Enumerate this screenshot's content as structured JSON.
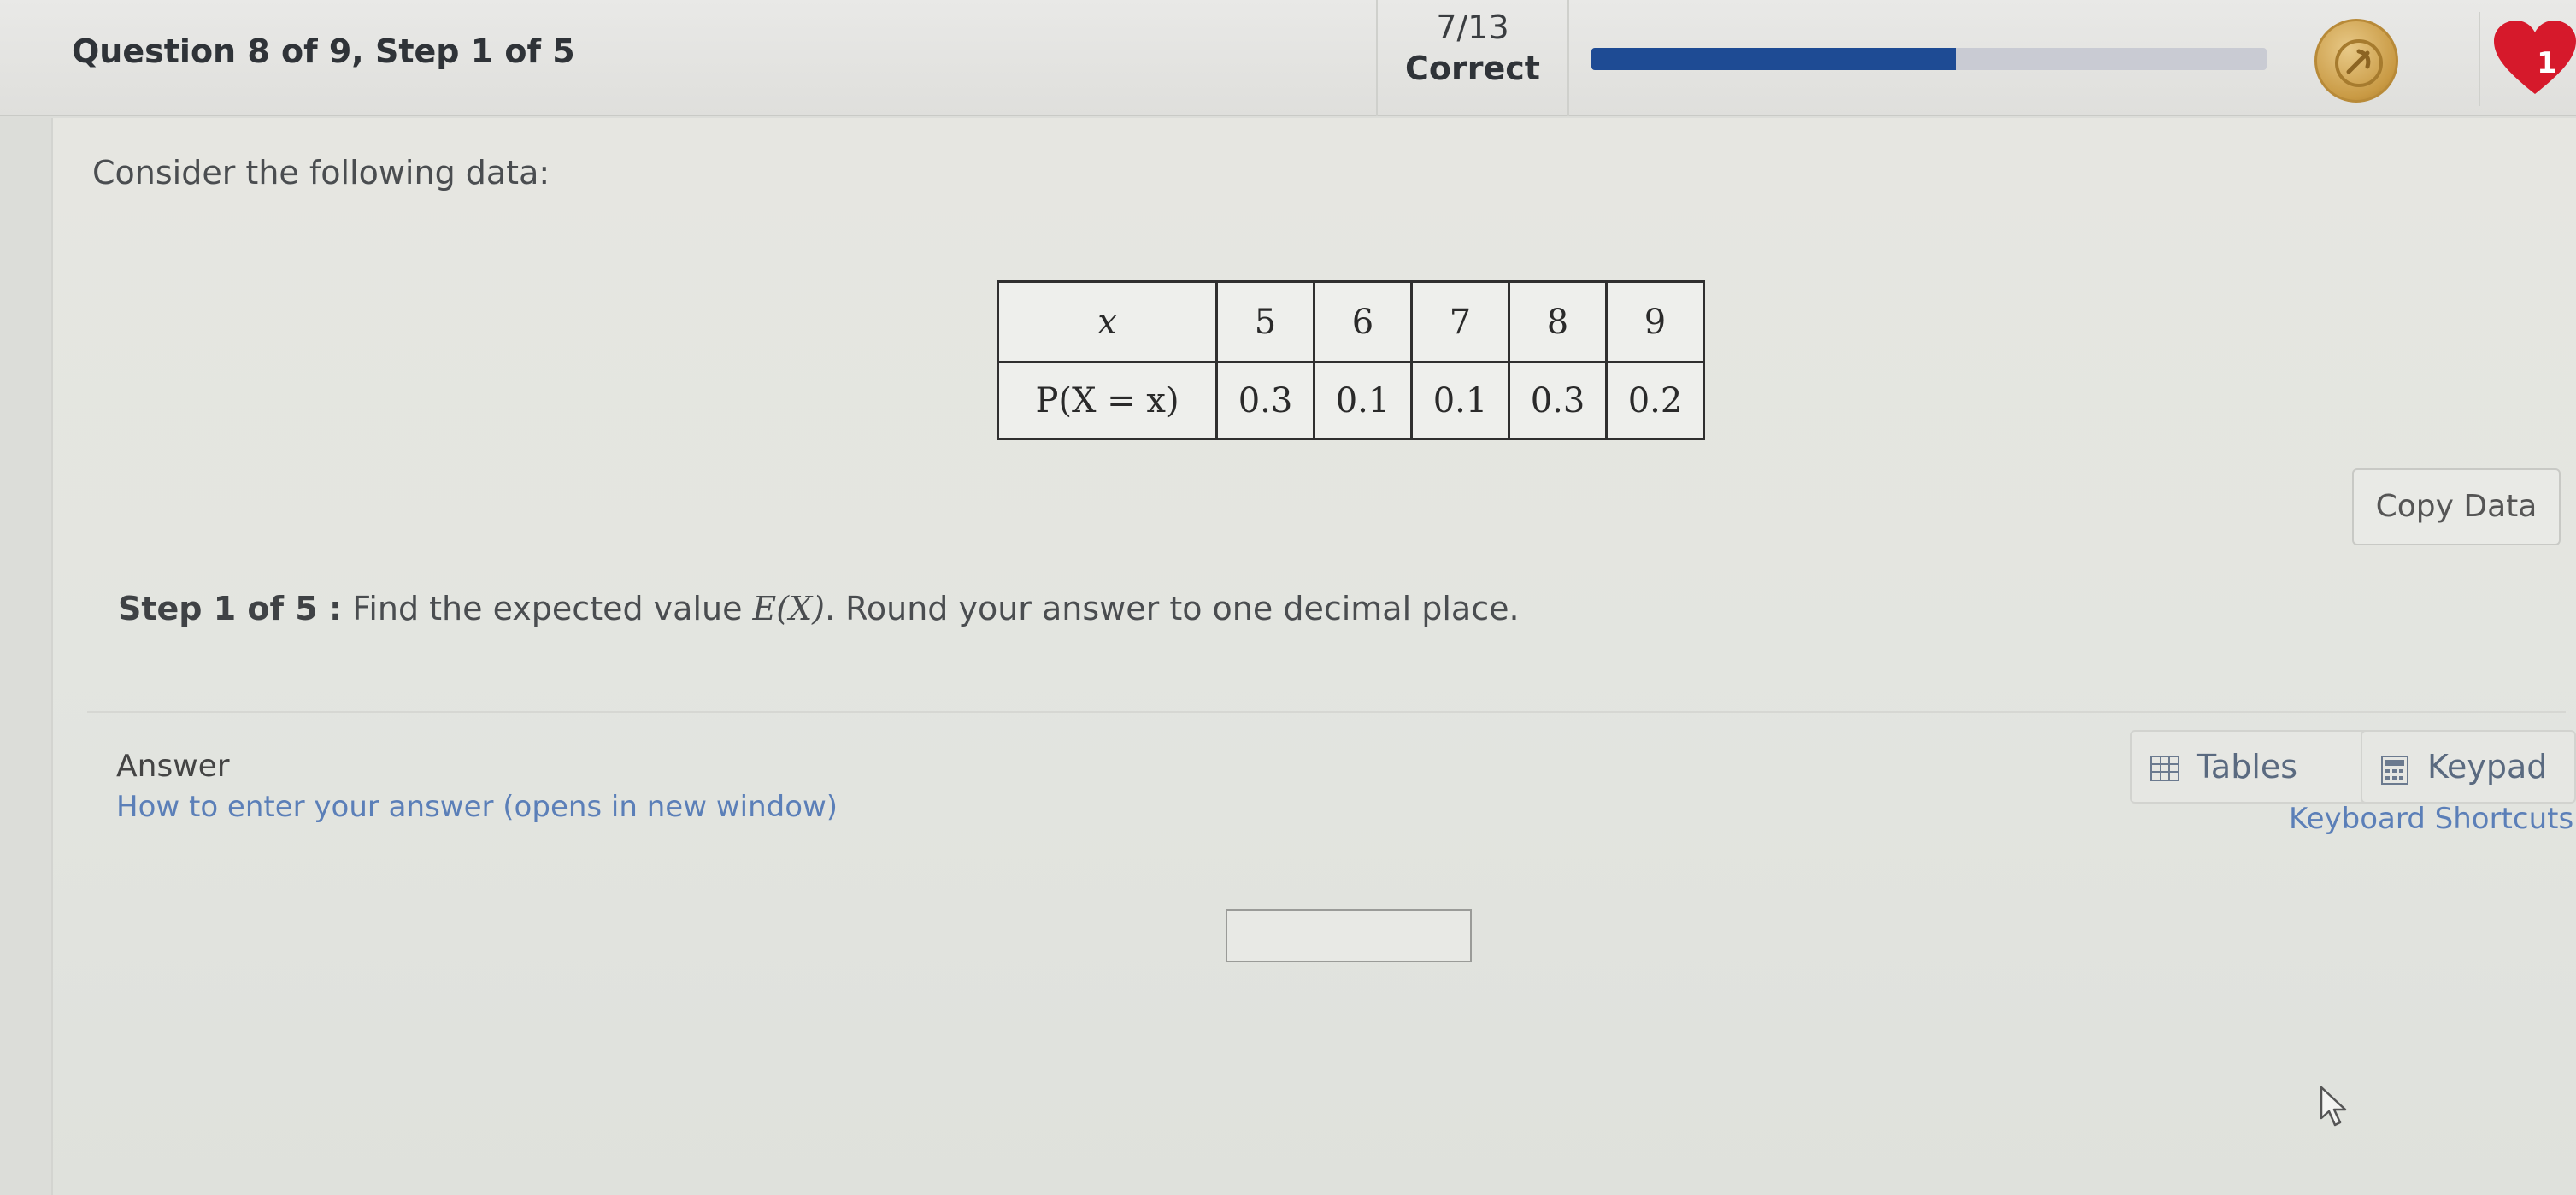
{
  "header": {
    "question_progress": "Question 8 of 9, Step 1 of 5",
    "score": "7/13",
    "score_label": "Correct",
    "progress_fraction": 0.54,
    "lives": "1",
    "accent_color": "#1e4b94",
    "heart_color": "#d6192b",
    "coin_icon": "coin-icon"
  },
  "question": {
    "intro": "Consider the following data:",
    "table": {
      "row1_header": "x",
      "row2_header": "P(X = x)",
      "x_values": [
        "5",
        "6",
        "7",
        "8",
        "9"
      ],
      "p_values": [
        "0.3",
        "0.1",
        "0.1",
        "0.3",
        "0.2"
      ]
    },
    "copy_data_label": "Copy Data",
    "step_label": "Step 1 of 5 :",
    "step_text_before": " Find the expected value ",
    "step_math": "E(X)",
    "step_text_after": ". Round your answer to one decimal place."
  },
  "answer": {
    "label": "Answer",
    "help_link": "How to enter your answer (opens in new window)",
    "tables_label": "Tables",
    "keypad_label": "Keypad",
    "keyboard_shortcuts": "Keyboard Shortcuts",
    "input_value": ""
  }
}
